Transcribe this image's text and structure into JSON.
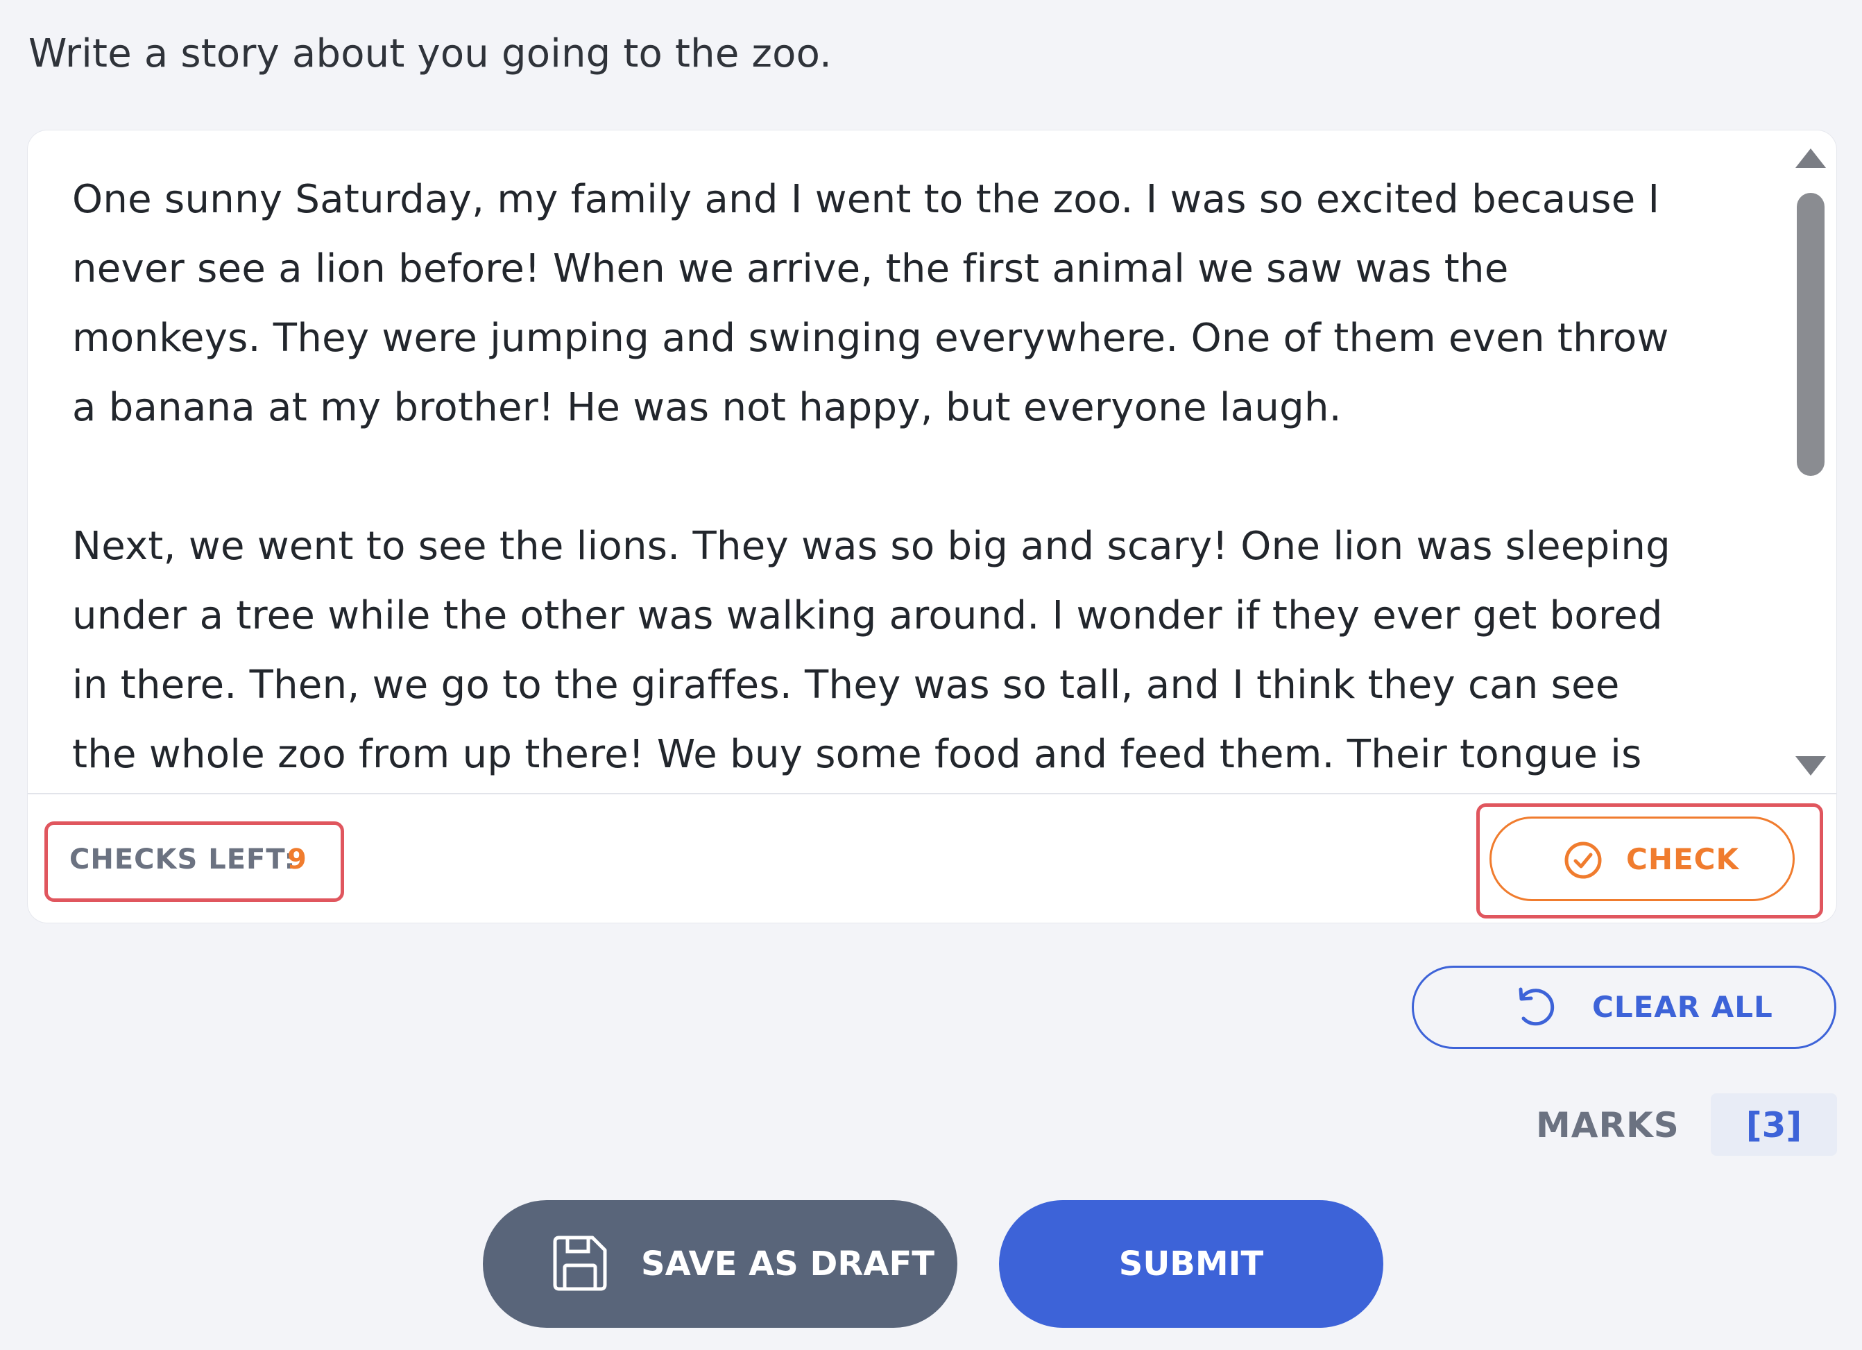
{
  "question": {
    "prompt": "Write a story about you going to the zoo."
  },
  "editor": {
    "text": "One sunny Saturday, my family and I went to the zoo. I was so excited because I\nnever see a lion before! When we arrive, the first animal we saw was the\nmonkeys. They were jumping and swinging everywhere. One of them even throw\na banana at my brother! He was not happy, but everyone laugh.\n\nNext, we went to see the lions. They was so big and scary! One lion was sleeping\nunder a tree while the other was walking around. I wonder if they ever get bored\nin there. Then, we go to the giraffes. They was so tall, and I think they can see\nthe whole zoo from up there! We buy some food and feed them. Their tongue is"
  },
  "checks": {
    "label": "CHECKS LEFT:",
    "value": "9",
    "button_label": "CHECK"
  },
  "actions": {
    "clear_label": "CLEAR ALL",
    "save_draft_label": "SAVE AS DRAFT",
    "submit_label": "SUBMIT"
  },
  "marks": {
    "label": "MARKS",
    "value": "[3]"
  },
  "icons": {
    "check": "check-circle-icon",
    "clear": "undo-icon",
    "save": "save-floppy-icon",
    "scroll_up": "scroll-up-arrow-icon",
    "scroll_down": "scroll-down-arrow-icon"
  },
  "colors": {
    "accent_orange": "#f07c2e",
    "accent_blue": "#3d63d8",
    "highlight_red": "#e0565e",
    "draft_gray": "#59657a",
    "background": "#f3f4f8"
  }
}
